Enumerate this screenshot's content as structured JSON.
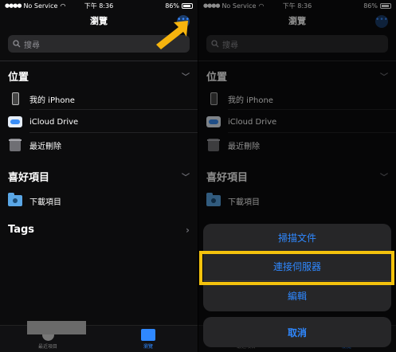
{
  "status": {
    "carrier": "No Service",
    "time": "下午 8:36",
    "battery": "86%"
  },
  "nav": {
    "title": "瀏覽",
    "more_label": "•••"
  },
  "search": {
    "placeholder": "搜尋"
  },
  "sections": {
    "locations": {
      "title": "位置",
      "items": [
        "我的 iPhone",
        "iCloud Drive",
        "最近刪除"
      ]
    },
    "favorites": {
      "title": "喜好項目",
      "items": [
        "下載項目"
      ]
    },
    "tags": {
      "title": "Tags"
    }
  },
  "tabbar": {
    "recent": "最近項目",
    "browse": "瀏覽"
  },
  "action_sheet": {
    "items": [
      "掃描文件",
      "連接伺服器",
      "編輯"
    ],
    "cancel": "取消"
  },
  "colors": {
    "accent": "#2f88ff",
    "highlight": "#f4c20d",
    "arrow": "#f6b40e"
  }
}
